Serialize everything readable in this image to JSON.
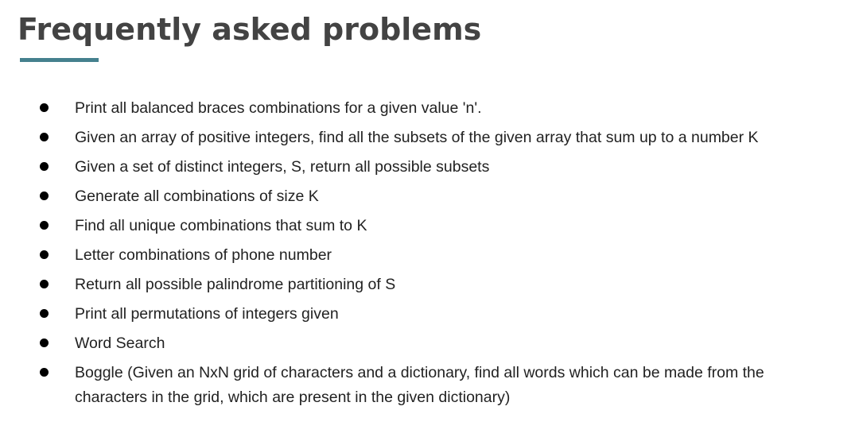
{
  "slide": {
    "title": "Frequently asked problems",
    "accent_color": "#45818e",
    "title_color": "#434343",
    "items": [
      "Print all balanced braces combinations for a given value 'n'.",
      "Given an array of positive integers, find all the subsets of the given array that sum up to a number K",
      "Given a set of distinct integers, S, return all possible subsets",
      "Generate all combinations of size K",
      "Find all unique combinations that sum to K",
      "Letter combinations of phone number",
      "Return all possible palindrome partitioning of S",
      "Print all permutations of integers given",
      "Word Search",
      "Boggle (Given an NxN grid of characters and a dictionary, find all words which can be made from the characters in the grid, which are present in the given dictionary)"
    ]
  }
}
